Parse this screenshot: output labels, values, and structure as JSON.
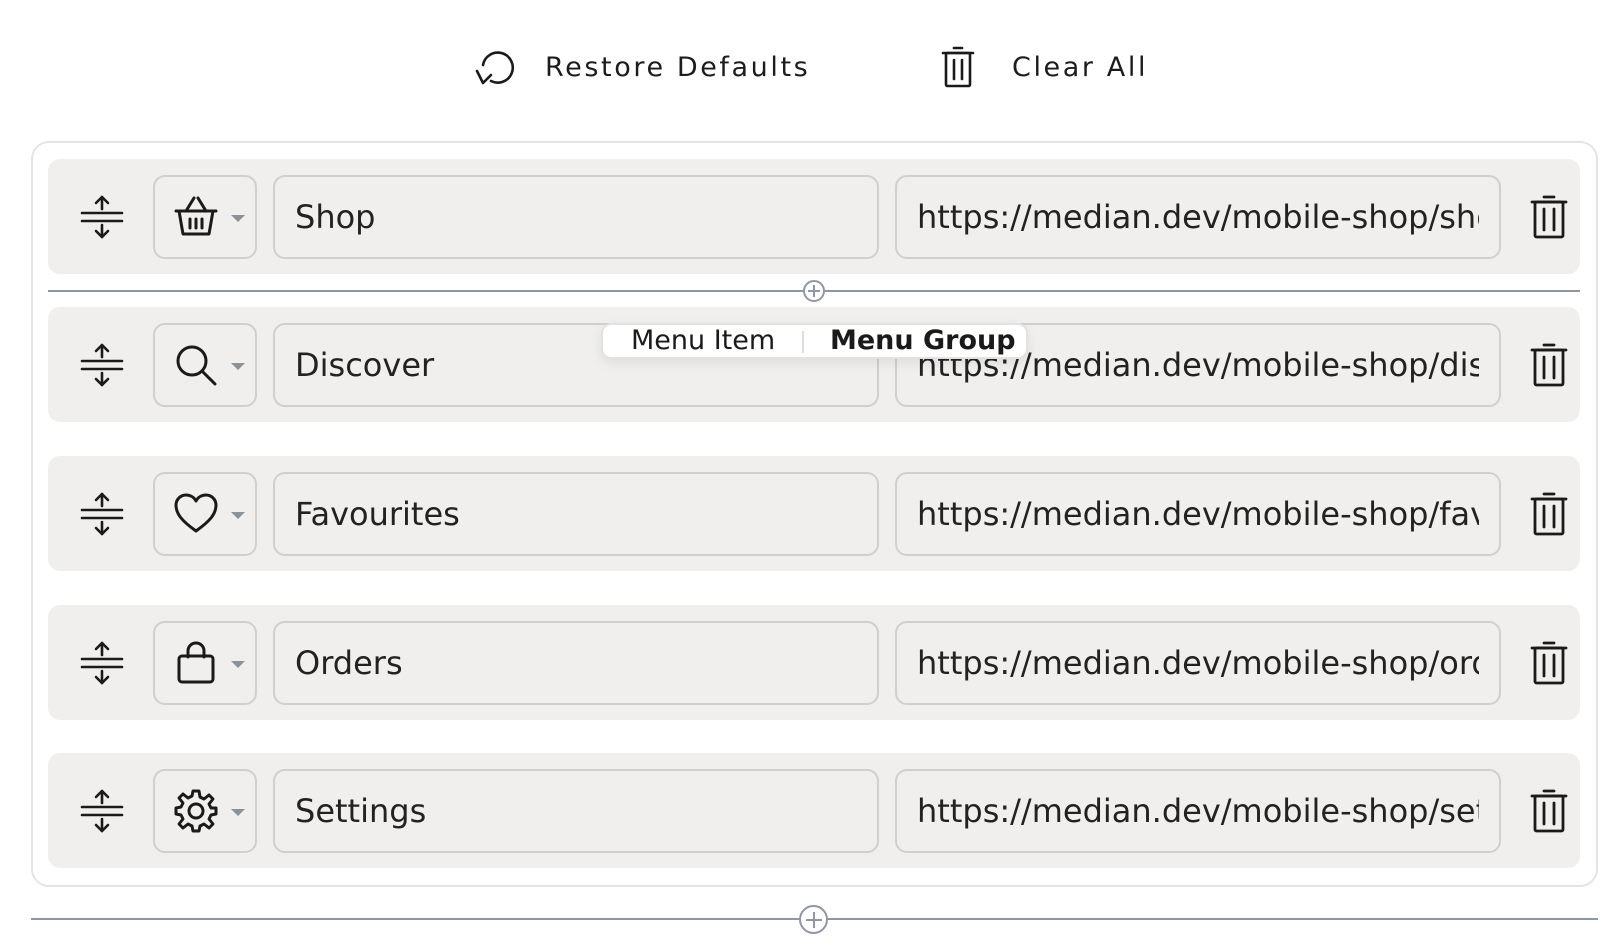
{
  "toolbar": {
    "restore_label": "Restore Defaults",
    "clear_label": "Clear All"
  },
  "menu_items": [
    {
      "icon": "basket-icon",
      "label": "Shop",
      "url": "https://median.dev/mobile-shop/shop"
    },
    {
      "icon": "search-icon",
      "label": "Discover",
      "url": "https://median.dev/mobile-shop/discover"
    },
    {
      "icon": "heart-icon",
      "label": "Favourites",
      "url": "https://median.dev/mobile-shop/favourites"
    },
    {
      "icon": "shopping-bag-icon",
      "label": "Orders",
      "url": "https://median.dev/mobile-shop/orders"
    },
    {
      "icon": "gear-icon",
      "label": "Settings",
      "url": "https://median.dev/mobile-shop/settings"
    }
  ],
  "add_popover": {
    "option_item": "Menu Item",
    "option_group": "Menu Group"
  },
  "colors": {
    "row_bg": "#f0efee",
    "border": "#d0cfcf",
    "divider": "#8f96a6"
  }
}
